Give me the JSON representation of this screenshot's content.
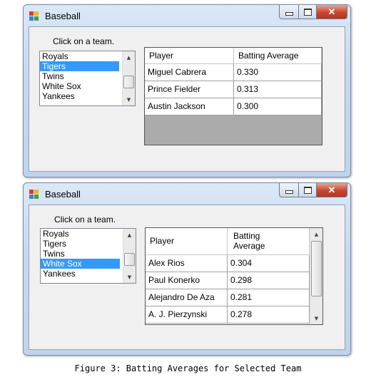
{
  "window1": {
    "title": "Baseball",
    "prompt": "Click on a team.",
    "teams": [
      "Royals",
      "Tigers",
      "Twins",
      "White Sox",
      "Yankees"
    ],
    "selected_team": "Tigers",
    "grid": {
      "headers": [
        "Player",
        "Batting Average"
      ],
      "rows": [
        [
          "Miguel Cabrera",
          "0.330"
        ],
        [
          "Prince Fielder",
          "0.313"
        ],
        [
          "Austin Jackson",
          "0.300"
        ]
      ]
    }
  },
  "window2": {
    "title": "Baseball",
    "prompt": "Click on a team.",
    "teams": [
      "Royals",
      "Tigers",
      "Twins",
      "White Sox",
      "Yankees"
    ],
    "selected_team": "White Sox",
    "grid": {
      "headers": [
        "Player",
        "Batting\nAverage"
      ],
      "rows": [
        [
          "Alex Rios",
          "0.304"
        ],
        [
          "Paul Konerko",
          "0.298"
        ],
        [
          "Alejandro De Aza",
          "0.281"
        ],
        [
          "A. J. Pierzynski",
          "0.278"
        ]
      ]
    }
  },
  "caption": "Figure 3: Batting Averages for Selected Team"
}
